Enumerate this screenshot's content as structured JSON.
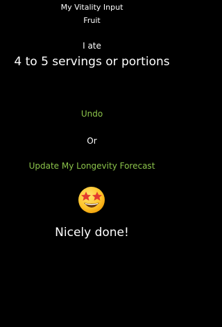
{
  "header": {
    "title": "My Vitality Input",
    "category": "Fruit"
  },
  "entry": {
    "intro": "I ate",
    "amount": "4 to 5 servings or portions"
  },
  "actions": {
    "undo_label": "Undo",
    "separator": "Or",
    "update_label": "Update My Longevity Forecast"
  },
  "feedback": {
    "emoji": "star-struck-emoji",
    "message": "Nicely done!"
  },
  "colors": {
    "background": "#000000",
    "text": "#ffffff",
    "accent_link": "#8bc34a"
  }
}
